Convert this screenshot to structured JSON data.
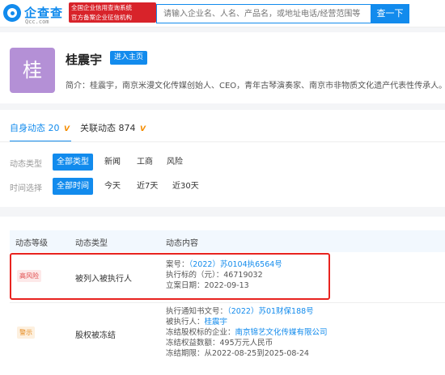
{
  "header": {
    "logo_name": "企查查",
    "logo_domain": "Qcc.com",
    "badge_line1": "全国企业信用查询系统",
    "badge_line2": "官方备案企业征信机构",
    "search_placeholder": "请输入企业名、人名、产品名，或地址电话/经营范围等",
    "search_button": "查一下"
  },
  "profile": {
    "avatar_char": "桂",
    "name": "桂震宇",
    "home_button": "进入主页",
    "bio": "简介：桂震宇，南京米漫文化传媒创始人、CEO，青年古琴演奏家、南京市非物质文化遗产代表性传承人。"
  },
  "tabs": [
    {
      "label": "自身动态",
      "count": "20",
      "vip": "V"
    },
    {
      "label": "关联动态",
      "count": "874",
      "vip": "V"
    }
  ],
  "filters": {
    "type_label": "动态类型",
    "type_options": [
      "全部类型",
      "新闻",
      "工商",
      "风险"
    ],
    "time_label": "时间选择",
    "time_options": [
      "全部时间",
      "今天",
      "近7天",
      "近30天"
    ]
  },
  "table": {
    "headers": [
      "动态等级",
      "动态类型",
      "动态内容"
    ],
    "rows": [
      {
        "level": "高风险",
        "type": "被列入被执行人",
        "details": [
          {
            "label": "案号：",
            "value": "（2022）苏0104执6564号",
            "link": true
          },
          {
            "label": "执行标的（元）：",
            "value": "46719032",
            "link": false
          },
          {
            "label": "立案日期：",
            "value": "2022-09-13",
            "link": false
          }
        ]
      },
      {
        "level": "警示",
        "type": "股权被冻结",
        "details": [
          {
            "label": "执行通知书文号：",
            "value": "（2022）苏01财保188号",
            "link": true
          },
          {
            "label": "被执行人：",
            "value": "桂震宇",
            "link": true
          },
          {
            "label": "冻结股权标的企业：",
            "value": "南京锦艺文化传媒有限公司",
            "link": true
          },
          {
            "label": "冻结权益数额：",
            "value": "495万元人民币",
            "link": false
          },
          {
            "label": "冻结期限：",
            "value": "从2022-08-25到2025-08-24",
            "link": false
          }
        ]
      }
    ]
  },
  "colors": {
    "accent": "#128bed",
    "danger": "#e8231f",
    "warn": "#e58a1f",
    "avatar": "#b490d6"
  }
}
